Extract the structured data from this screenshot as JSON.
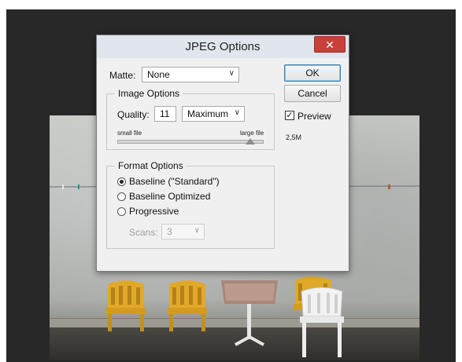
{
  "dialog": {
    "title": "JPEG Options",
    "close_glyph": "✕"
  },
  "matte": {
    "label": "Matte:",
    "value": "None"
  },
  "image_options": {
    "title": "Image Options",
    "quality_label": "Quality:",
    "quality_value": "11",
    "quality_preset": "Maximum",
    "small_file_label": "small file",
    "large_file_label": "large file",
    "slider_level_percent": 92
  },
  "format_options": {
    "title": "Format Options",
    "options": [
      {
        "label": "Baseline (\"Standard\")",
        "selected": true
      },
      {
        "label": "Baseline Optimized",
        "selected": false
      },
      {
        "label": "Progressive",
        "selected": false
      }
    ],
    "scans_label": "Scans:",
    "scans_value": "3"
  },
  "buttons": {
    "ok": "OK",
    "cancel": "Cancel"
  },
  "preview": {
    "label": "Preview",
    "checked": true,
    "file_size": "2,5M"
  },
  "icons": {
    "chevron": "chevron-down-icon",
    "close": "close-icon",
    "check": "check-icon"
  },
  "colors": {
    "close_button": "#c9403a",
    "workspace": "#282828",
    "dialog_bg": "#f0f0f0"
  }
}
